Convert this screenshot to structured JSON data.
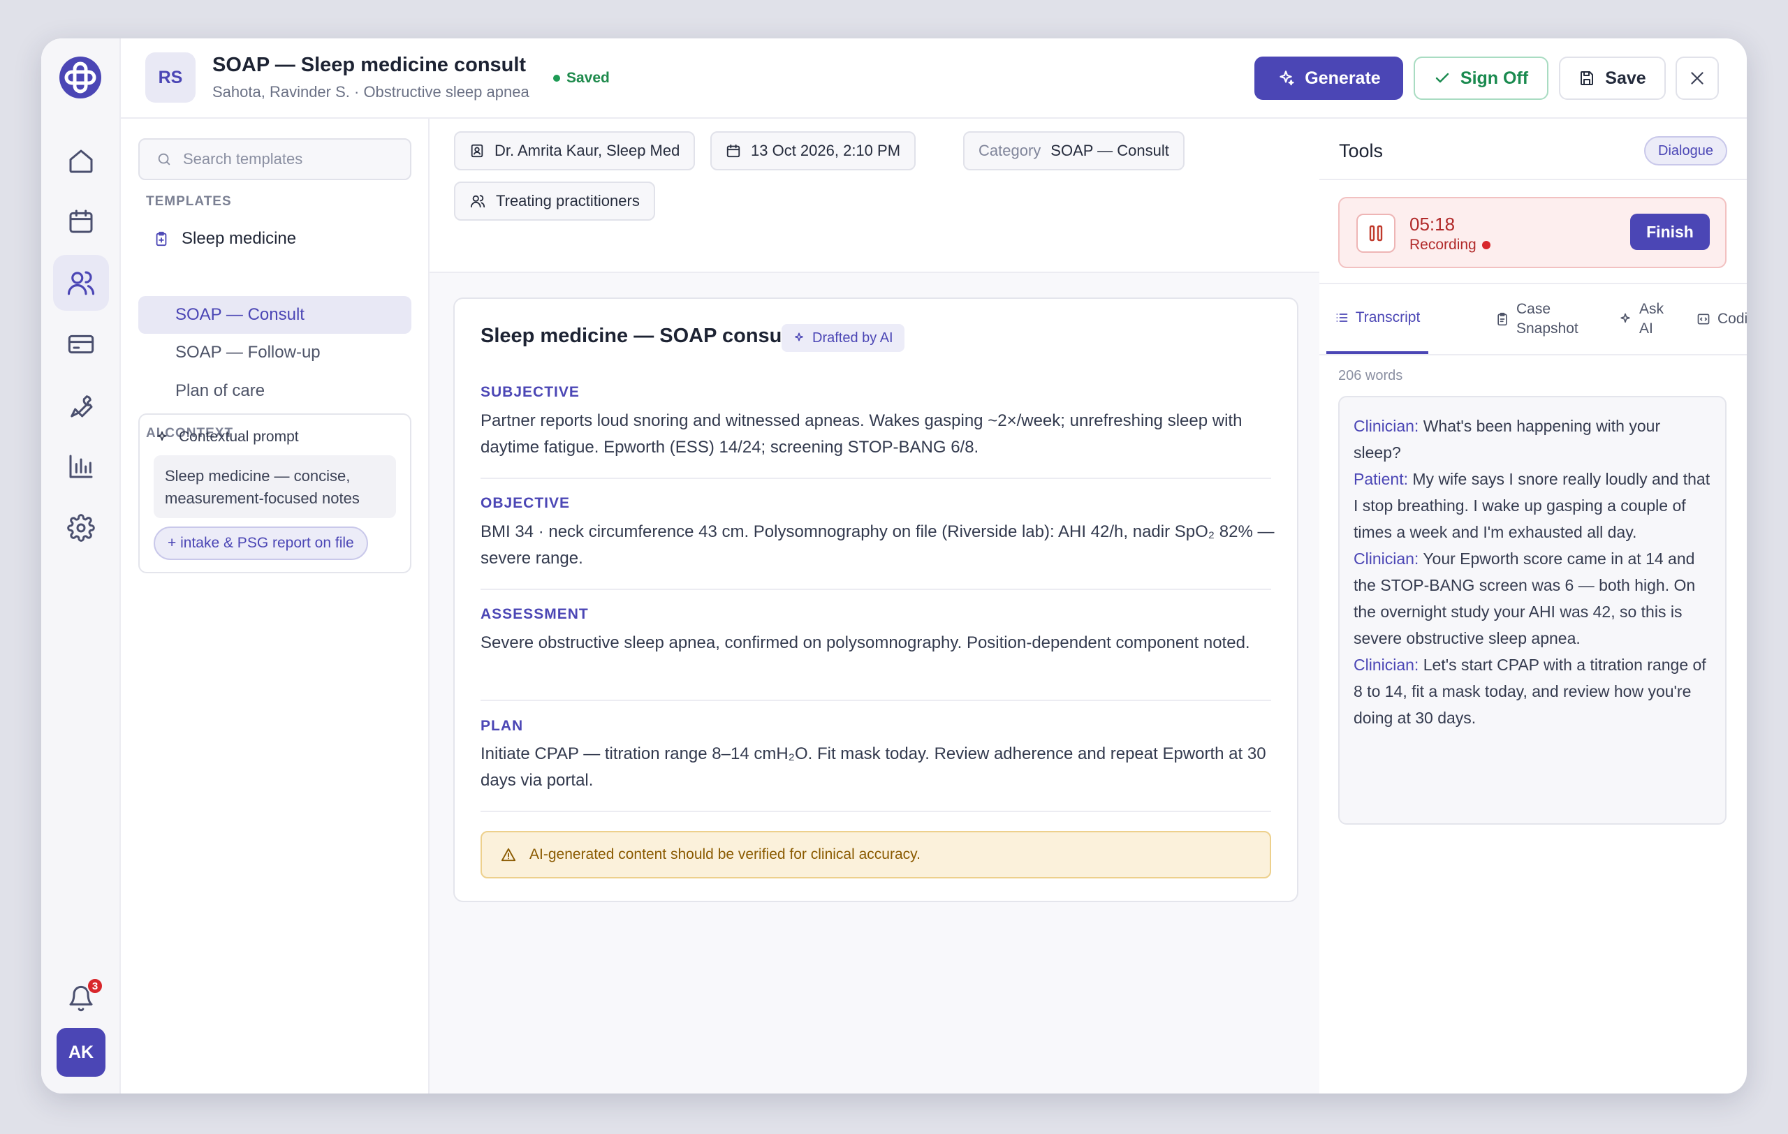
{
  "header": {
    "patient_initials": "RS",
    "title": "SOAP — Sleep medicine consult",
    "subtitle": "Sahota, Ravinder S. · Obstructive sleep apnea",
    "status": "Saved",
    "buttons": {
      "generate": "Generate",
      "sign_off": "Sign Off",
      "save": "Save"
    }
  },
  "sidebar": {
    "icons": [
      "home-icon",
      "calendar-icon",
      "users-icon",
      "card-icon",
      "wrench-icon",
      "chart-icon",
      "gear-icon"
    ],
    "notification_count": "3",
    "user_initials": "AK"
  },
  "left_panel": {
    "search_placeholder": "Search templates",
    "templates_heading": "TEMPLATES",
    "group_label": "Sleep medicine",
    "items": [
      "SOAP — Consult",
      "SOAP — Follow-up",
      "Plan of care"
    ],
    "active_index": 0,
    "ai_context_heading": "AI CONTEXT",
    "context_title": "Contextual prompt",
    "context_body": "Sleep medicine — concise, measurement-focused notes",
    "context_pill": "+ intake & PSG report on file"
  },
  "meta": {
    "practitioner": "Dr. Amrita Kaur, Sleep Med",
    "datetime": "13 Oct 2026, 2:10 PM",
    "category_label": "Category",
    "category_value": "SOAP — Consult",
    "treating": "Treating practitioners"
  },
  "note": {
    "title": "Sleep medicine — SOAP consult",
    "badge": "Drafted by AI",
    "sections": [
      {
        "label": "SUBJECTIVE",
        "text": "Partner reports loud snoring and witnessed apneas. Wakes gasping ~2×/week; unrefreshing sleep with daytime fatigue. Epworth (ESS) 14/24; screening STOP-BANG 6/8."
      },
      {
        "label": "OBJECTIVE",
        "text": "BMI 34 · neck circumference 43 cm. Polysomnography on file (Riverside lab): AHI 42/h, nadir SpO₂ 82% — severe range."
      },
      {
        "label": "ASSESSMENT",
        "text": "Severe obstructive sleep apnea, confirmed on polysomnography. Position-dependent component noted."
      },
      {
        "label": "PLAN",
        "text": "Initiate CPAP — titration range 8–14 cmH₂O. Fit mask today. Review adherence and repeat Epworth at 30 days via portal."
      }
    ],
    "warning": "AI-generated content should be verified for clinical accuracy."
  },
  "tools": {
    "title": "Tools",
    "mode": "Dialogue",
    "recording": {
      "time": "05:18",
      "status": "Recording",
      "finish": "Finish"
    },
    "tabs": [
      "Transcript",
      "Case Snapshot",
      "Ask AI",
      "Coding"
    ],
    "active_tab": 0,
    "word_count": "206 words",
    "transcript": [
      {
        "speaker": "Clinician:",
        "text": "What's been happening with your sleep?"
      },
      {
        "speaker": "Patient:",
        "text": "My wife says I snore really loudly and that I stop breathing. I wake up gasping a couple of times a week and I'm exhausted all day."
      },
      {
        "speaker": "Clinician:",
        "text": "Your Epworth score came in at 14 and the STOP-BANG screen was 6 — both high. On the overnight study your AHI was 42, so this is severe obstructive sleep apnea."
      },
      {
        "speaker": "Clinician:",
        "text": "Let's start CPAP with a titration range of 8 to 14, fit a mask today, and review how you're doing at 30 days."
      }
    ]
  },
  "colors": {
    "accent": "#4b46b5",
    "success": "#1a8a4f",
    "danger": "#d8262b",
    "warning_bg": "#fbf1db"
  }
}
